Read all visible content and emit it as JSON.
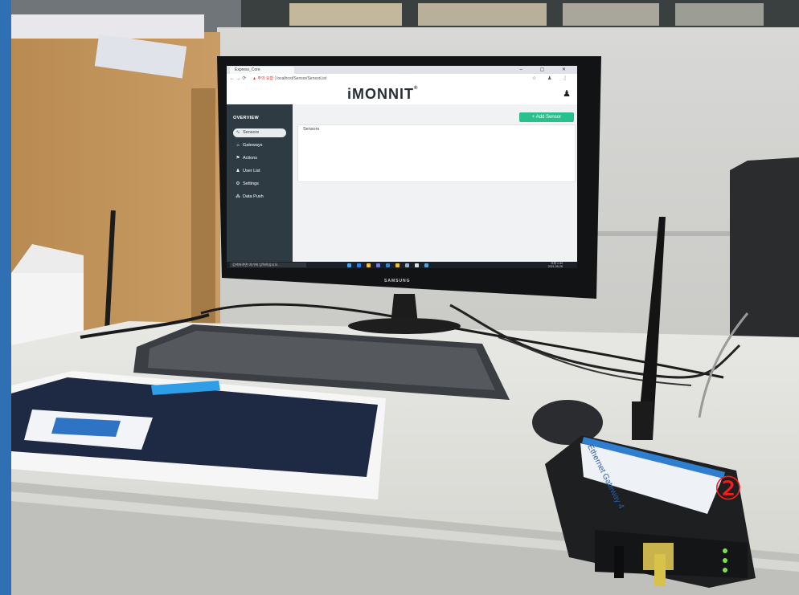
{
  "browser": {
    "tab_title": "Express_Core",
    "window_controls": "– ▢ ✕",
    "nav_buttons": "← → ⟳",
    "security_warning": "▲ 주의 요함",
    "address": "localhost/Sensor/SensorList",
    "toolbar_icons": "☆ ♟ ⋮"
  },
  "app": {
    "logo": "MONNIT",
    "logo_prefix": "i",
    "logo_mark": "®",
    "user_icon": "person-icon",
    "sidebar": {
      "title": "OVERVIEW",
      "items": [
        {
          "label": "Sensors",
          "icon": "sensor-pulse-icon"
        },
        {
          "label": "Gateways",
          "icon": "gateway-icon"
        },
        {
          "label": "Actions",
          "icon": "actions-icon"
        },
        {
          "label": "User List",
          "icon": "users-icon"
        },
        {
          "label": "Settings",
          "icon": "gear-icon"
        },
        {
          "label": "Data Push",
          "icon": "network-icon"
        }
      ]
    },
    "add_sensor_label": "+ Add Sensor",
    "sensor_panel_title": "Sensors"
  },
  "taskbar": {
    "search_placeholder": "검색하려면 여기에 입력하십시오.",
    "time": "오후 1:43",
    "date": "2021-05-26"
  },
  "monitor_brand": "SAMSUNG",
  "annotation_number": "②",
  "gateway_box_text": "Ethernet Gateway 4",
  "colors": {
    "add_button": "#28c08c",
    "sidebar": "#2f3b43",
    "annotation": "#ff1a1a"
  }
}
